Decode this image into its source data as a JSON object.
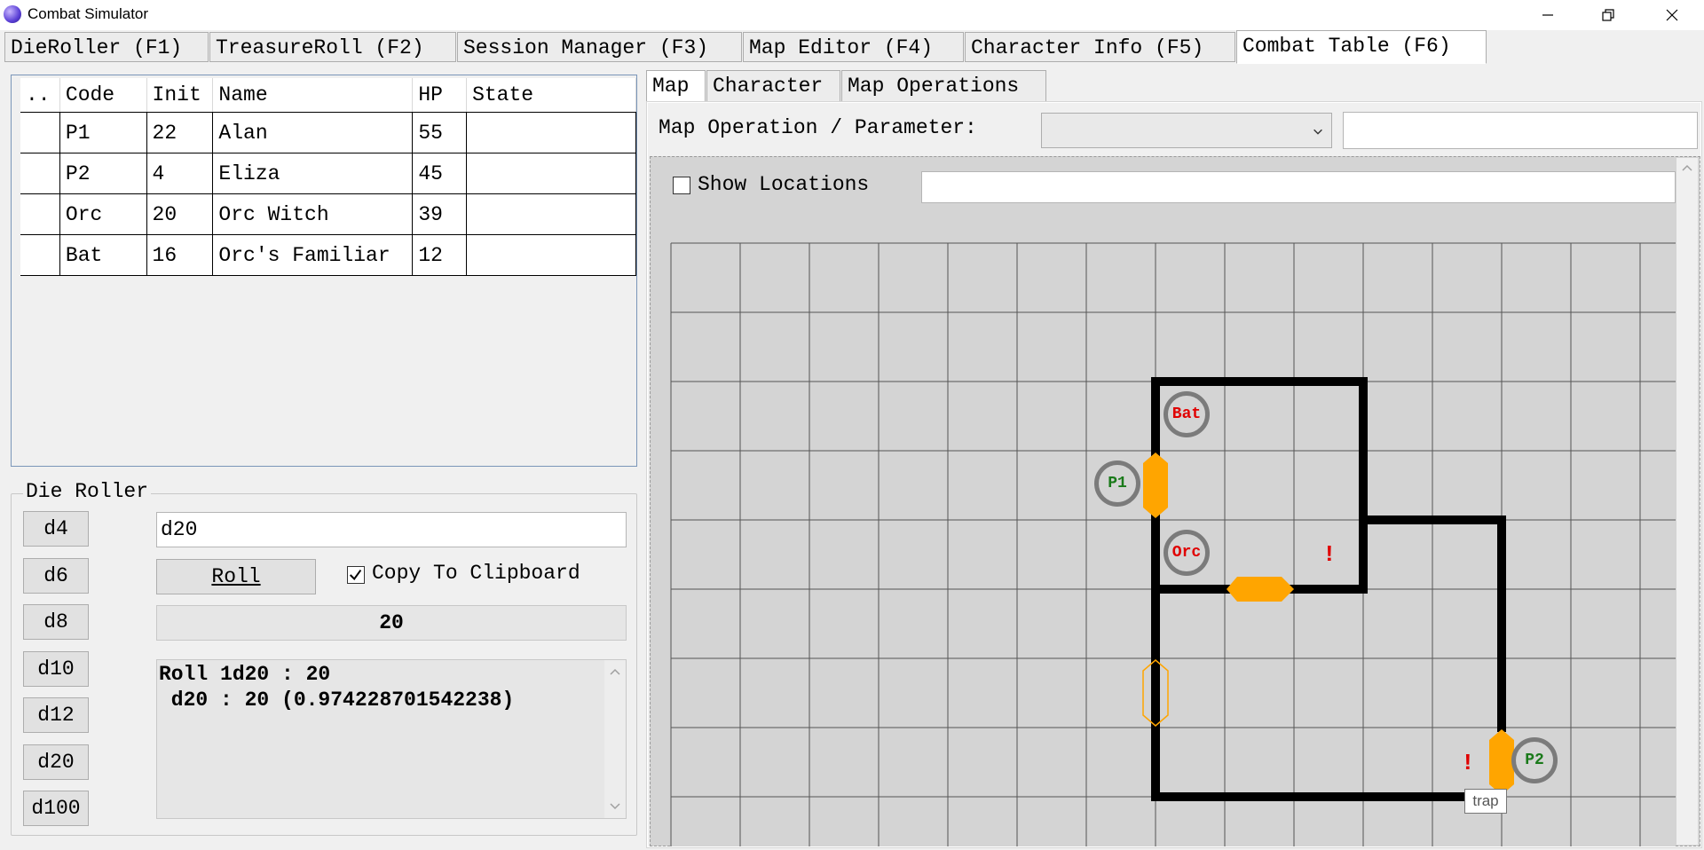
{
  "window": {
    "title": "Combat Simulator"
  },
  "main_tabs": [
    {
      "label": "DieRoller (F1)"
    },
    {
      "label": "TreasureRoll (F2)"
    },
    {
      "label": "Session Manager (F3)"
    },
    {
      "label": "Map Editor (F4)"
    },
    {
      "label": "Character Info (F5)"
    },
    {
      "label": "Combat Table (F6)",
      "active": true
    }
  ],
  "combat_table": {
    "columns": [
      "..",
      "Code",
      "Init",
      "Name",
      "HP",
      "State"
    ],
    "rows": [
      {
        "code": "P1",
        "init": "22",
        "name": "Alan",
        "hp": "55",
        "state": ""
      },
      {
        "code": "P2",
        "init": "4",
        "name": "Eliza",
        "hp": "45",
        "state": ""
      },
      {
        "code": "Orc",
        "init": "20",
        "name": "Orc Witch",
        "hp": "39",
        "state": ""
      },
      {
        "code": "Bat",
        "init": "16",
        "name": "Orc's Familiar",
        "hp": "12",
        "state": ""
      }
    ]
  },
  "die_roller": {
    "legend": "Die Roller",
    "dice": [
      "d4",
      "d6",
      "d8",
      "d10",
      "d12",
      "d20",
      "d100"
    ],
    "input_value": "d20",
    "roll_label": "Roll",
    "copy_label": "Copy To Clipboard",
    "copy_checked": true,
    "result": "20",
    "log_line1": "Roll 1d20 : 20",
    "log_line2": " d20 : 20 (0.974228701542238)"
  },
  "sub_tabs": [
    {
      "label": "Map",
      "active": true
    },
    {
      "label": "Character"
    },
    {
      "label": "Map Operations"
    }
  ],
  "map_ops": {
    "label": "Map Operation / Parameter:",
    "select_value": "",
    "param_value": "",
    "show_locations_label": "Show Locations",
    "show_locations_checked": false,
    "locations_value": ""
  },
  "map": {
    "tokens": [
      {
        "label": "Bat",
        "color": "#e00000"
      },
      {
        "label": "P1",
        "color": "#1a7a1a"
      },
      {
        "label": "Orc",
        "color": "#e00000"
      },
      {
        "label": "P2",
        "color": "#1a7a1a"
      }
    ],
    "markers": [
      "!",
      "!"
    ],
    "door_color": "#ffa500",
    "tooltip": "trap"
  }
}
